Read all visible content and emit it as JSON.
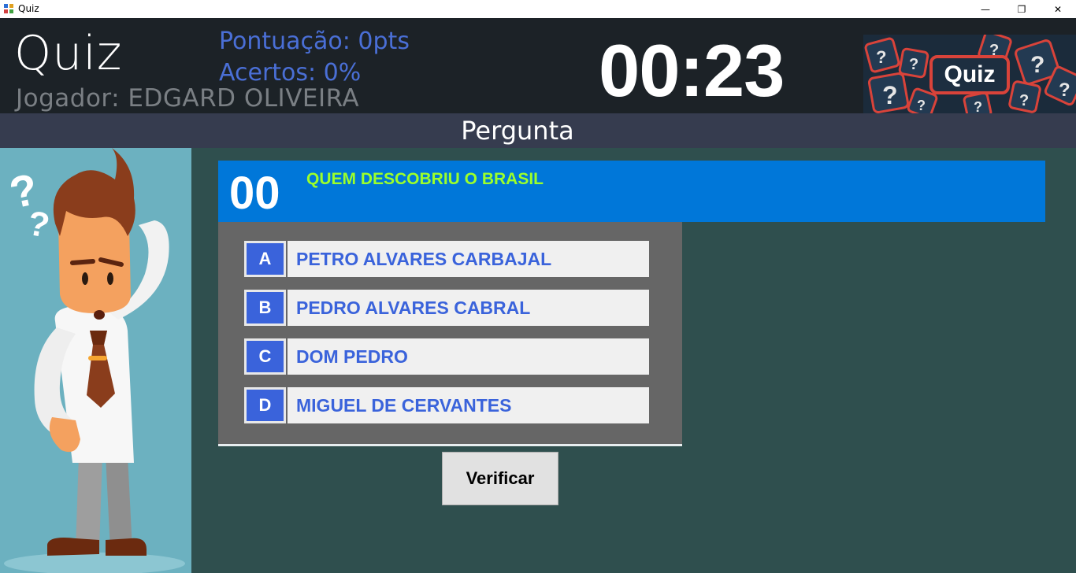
{
  "window": {
    "title": "Quiz",
    "controls": {
      "minimize": "—",
      "maximize": "❐",
      "close": "✕"
    }
  },
  "header": {
    "app_title": "Quiz",
    "player": "Jogador: EDGARD OLIVEIRA",
    "score": "Pontuação: 0pts",
    "hits": "Acertos: 0%",
    "timer": "00:23",
    "logo_text": "Quiz"
  },
  "section": {
    "title": "Pergunta"
  },
  "question": {
    "number": "00",
    "text": "QUEM DESCOBRIU O BRASIL"
  },
  "answers": [
    {
      "letter": "A",
      "text": "PETRO ALVARES CARBAJAL"
    },
    {
      "letter": "B",
      "text": "PEDRO ALVARES CABRAL"
    },
    {
      "letter": "C",
      "text": "DOM PEDRO"
    },
    {
      "letter": "D",
      "text": "MIGUEL DE CERVANTES"
    }
  ],
  "actions": {
    "verify_label": "Verificar"
  },
  "colors": {
    "header_bg": "#1c2227",
    "accent_blue": "#0077d9",
    "question_text": "#9cff2a",
    "answer_blue": "#3a63db",
    "content_bg": "#2f4f4e"
  }
}
